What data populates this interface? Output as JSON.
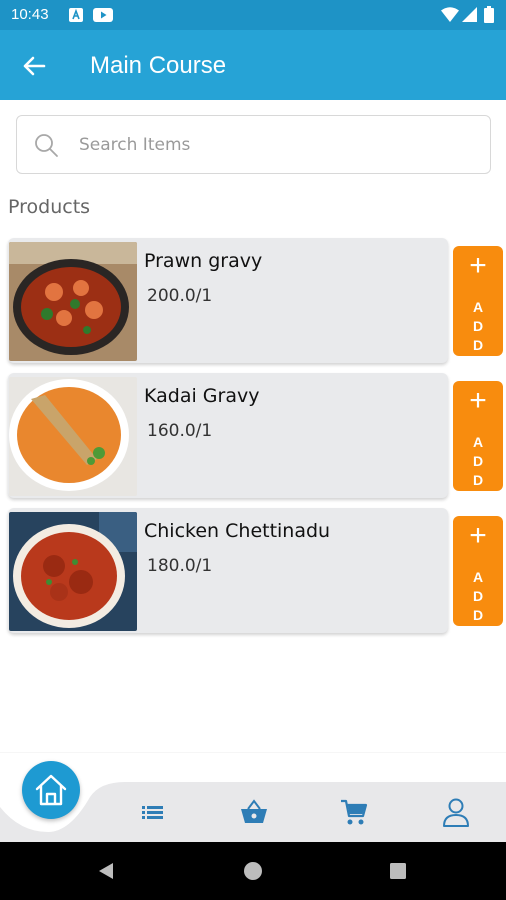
{
  "status_bar": {
    "time": "10:43"
  },
  "app_bar": {
    "title": "Main Course"
  },
  "search": {
    "placeholder": "Search Items"
  },
  "section_label": "Products",
  "products": [
    {
      "name": "Prawn gravy",
      "price": "200.0/1"
    },
    {
      "name": "Kadai Gravy",
      "price": "160.0/1"
    },
    {
      "name": "Chicken Chettinadu",
      "price": "180.0/1"
    }
  ],
  "add_button": {
    "plus": "+",
    "letters": [
      "A",
      "D",
      "D"
    ]
  },
  "bottom_nav": {
    "items": [
      "home-icon",
      "list-icon",
      "basket-icon",
      "cart-icon",
      "profile-icon"
    ]
  },
  "colors": {
    "status_bar": "#1e93c6",
    "app_bar": "#26a3d6",
    "accent_orange": "#f88c0e",
    "home_fab": "#1e9ad2",
    "card_bg": "#e9eaec"
  }
}
